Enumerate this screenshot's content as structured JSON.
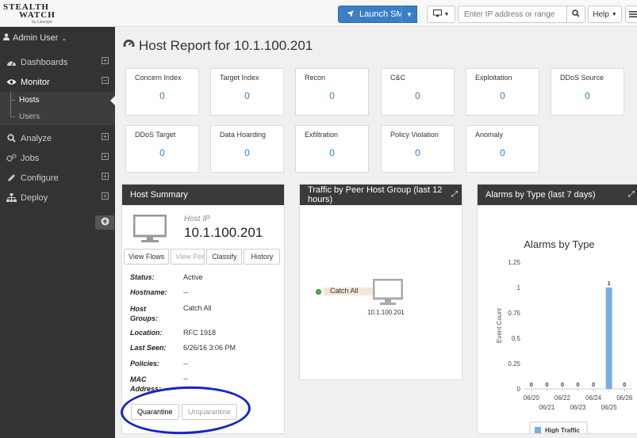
{
  "header": {
    "logo_line1": "STEALTH",
    "logo_line2": "WATCH",
    "logo_sub": "by Lancope",
    "launch_label": "Launch SMC",
    "ip_placeholder": "Enter IP address or range",
    "help_label": "Help"
  },
  "sidebar": {
    "user_label": "Admin User",
    "items": [
      {
        "label": "Dashboards",
        "expander": "+"
      },
      {
        "label": "Monitor",
        "expander": "−"
      },
      {
        "label": "Analyze",
        "expander": "+"
      },
      {
        "label": "Jobs",
        "expander": "+"
      },
      {
        "label": "Configure",
        "expander": "+"
      },
      {
        "label": "Deploy",
        "expander": "+"
      }
    ],
    "subitems": [
      {
        "label": "Hosts"
      },
      {
        "label": "Users"
      }
    ]
  },
  "page": {
    "title": "Host Report for 10.1.100.201"
  },
  "stats": [
    {
      "label": "Concern Index",
      "value": "0"
    },
    {
      "label": "Target Index",
      "value": "0"
    },
    {
      "label": "Recon",
      "value": "0"
    },
    {
      "label": "C&C",
      "value": "0"
    },
    {
      "label": "Exploitation",
      "value": "0"
    },
    {
      "label": "DDoS Source",
      "value": "0"
    },
    {
      "label": "DDoS Target",
      "value": "0"
    },
    {
      "label": "Data Hoarding",
      "value": "0"
    },
    {
      "label": "Exfiltration",
      "value": "0"
    },
    {
      "label": "Policy Violation",
      "value": "0"
    },
    {
      "label": "Anomaly",
      "value": "0"
    }
  ],
  "host_summary": {
    "title": "Host Summary",
    "ip_label": "Host IP",
    "ip": "10.1.100.201",
    "buttons": [
      "View Flows",
      "View Peers",
      "Classify",
      "History"
    ],
    "fields": [
      {
        "key": "Status:",
        "value": "Active"
      },
      {
        "key": "Hostname:",
        "value": "--"
      },
      {
        "key": "Host Groups:",
        "value": "Catch All"
      },
      {
        "key": "Location:",
        "value": "RFC 1918"
      },
      {
        "key": "Last Seen:",
        "value": "6/26/16 3:06 PM"
      },
      {
        "key": "Policies:",
        "value": "--"
      },
      {
        "key": "MAC Address:",
        "value": "--"
      }
    ],
    "quarantine_label": "Quarantine",
    "unquarantine_label": "Unquarantine"
  },
  "traffic_panel": {
    "title": "Traffic by Peer Host Group (last 12 hours)",
    "group_label": "Catch All",
    "host_ip": "10.1.100.201"
  },
  "alarms_panel": {
    "title": "Alarms by Type (last 7 days)"
  },
  "chart_data": {
    "type": "bar",
    "title": "Alarms by Type",
    "ylabel": "Event Count",
    "xlabel": "",
    "categories": [
      "06/20",
      "06/21",
      "06/22",
      "06/23",
      "06/24",
      "06/25",
      "06/26"
    ],
    "ylim": [
      0,
      1.25
    ],
    "yticks": [
      "0",
      "0.25",
      "0.5",
      "0.75",
      "1",
      "1.25"
    ],
    "series": [
      {
        "name": "High Traffic",
        "values": [
          0,
          0,
          0,
          0,
          0,
          1,
          0
        ]
      }
    ],
    "bar_color": "#7aaee0",
    "legend_position": "bottom"
  },
  "colors": {
    "accent": "#3a7ec6",
    "sidebar": "#333333",
    "annotation": "#1424c8"
  }
}
